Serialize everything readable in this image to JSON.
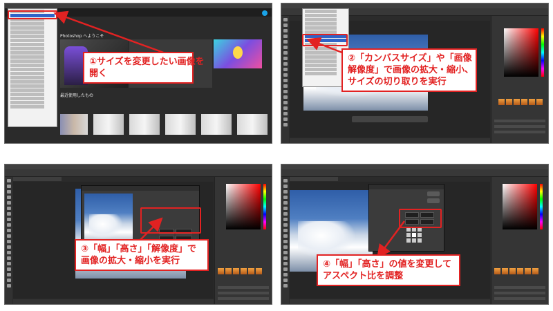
{
  "colors": {
    "accent_red": "#e22222",
    "ps_dark": "#2b2b2b",
    "menu_highlight": "#2f64c8"
  },
  "steps": [
    {
      "number": 1,
      "lines": [
        "①サイズを変更したい画像を",
        "開く"
      ]
    },
    {
      "number": 2,
      "lines": [
        "②「カンバスサイズ」や「画像",
        "解像度」で画像の拡大・縮小、",
        "サイズの切り取りを実行"
      ]
    },
    {
      "number": 3,
      "lines": [
        "③「幅」「高さ」「解像度」で",
        "画像の拡大・縮小を実行"
      ]
    },
    {
      "number": 4,
      "lines": [
        "④「幅」「高さ」の値を変更して",
        "アスペクト比を調整"
      ]
    }
  ],
  "home_screen": {
    "welcome": "Photoshop へようこそ",
    "recent": "最近使用したもの"
  }
}
